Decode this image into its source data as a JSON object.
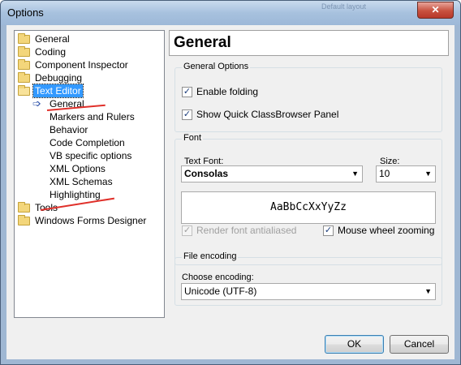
{
  "window": {
    "title": "Options",
    "ghost_texts": [
      "Default layout"
    ],
    "close_glyph": "✕"
  },
  "tree": {
    "items": [
      {
        "label": "General",
        "icon": "folder-icon"
      },
      {
        "label": "Coding",
        "icon": "folder-icon"
      },
      {
        "label": "Component Inspector",
        "icon": "folder-icon"
      },
      {
        "label": "Debugging",
        "icon": "folder-icon"
      },
      {
        "label": "Text Editor",
        "icon": "open-folder-icon",
        "selected": true
      },
      {
        "label": "General",
        "icon": "arrow-right-icon",
        "child": true
      },
      {
        "label": "Markers and Rulers",
        "child": true
      },
      {
        "label": "Behavior",
        "child": true
      },
      {
        "label": "Code Completion",
        "child": true
      },
      {
        "label": "VB specific options",
        "child": true
      },
      {
        "label": "XML Options",
        "child": true
      },
      {
        "label": "XML Schemas",
        "child": true
      },
      {
        "label": "Highlighting",
        "child": true
      },
      {
        "label": "Tools",
        "icon": "folder-icon"
      },
      {
        "label": "Windows Forms Designer",
        "icon": "folder-icon"
      }
    ]
  },
  "panel": {
    "title": "General",
    "general_options": {
      "label": "General Options",
      "enable_folding": {
        "label": "Enable folding",
        "checked": true
      },
      "show_classbrowser": {
        "label": "Show Quick ClassBrowser Panel",
        "checked": true
      }
    },
    "font": {
      "label": "Font",
      "text_font_label": "Text Font:",
      "text_font_value": "Consolas",
      "size_label": "Size:",
      "size_value": "10",
      "preview_text": "AaBbCcXxYyZz",
      "antialiased": {
        "label": "Render font antialiased",
        "checked": true,
        "enabled": false
      },
      "mouse_wheel": {
        "label": "Mouse wheel zooming",
        "checked": true
      }
    },
    "file_encoding": {
      "label": "File encoding",
      "choose_label": "Choose encoding:",
      "encoding_value": "Unicode (UTF-8)"
    }
  },
  "buttons": {
    "ok": "OK",
    "cancel": "Cancel"
  },
  "colors": {
    "selection": "#3399ff",
    "annotation_red": "#e0302a"
  },
  "glyphs": {
    "check": "✓",
    "dropdown": "▼",
    "arrow": "➩"
  }
}
